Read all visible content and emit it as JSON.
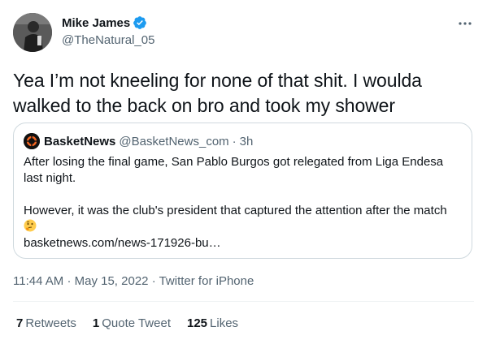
{
  "author": {
    "display_name": "Mike James",
    "handle": "@TheNatural_05"
  },
  "tweet": {
    "text": "Yea I’m not kneeling for none of that shit. I woulda walked to the back on bro and took my shower"
  },
  "quoted": {
    "display_name": "BasketNews",
    "handle": "@BasketNews_com",
    "separator": "·",
    "time": "3h",
    "paragraph_1": "After losing the final game, San Pablo Burgos got relegated from Liga Endesa last night.",
    "paragraph_2": "However, it was the club's president that captured the attention after the match",
    "link": "basketnews.com/news-171926-bu…"
  },
  "meta": {
    "time": "11:44 AM",
    "separator": "·",
    "date": "May 15, 2022",
    "source": "Twitter for iPhone"
  },
  "stats": {
    "retweets_count": "7",
    "retweets_label": "Retweets",
    "quotes_count": "1",
    "quotes_label": "Quote Tweet",
    "likes_count": "125",
    "likes_label": "Likes"
  },
  "icons": {
    "verified": "verified-badge-icon",
    "more": "more-options-icon",
    "quoted_avatar": "basketnews-logo",
    "emoji": "thinking-face-emoji"
  },
  "colors": {
    "text": "#0f1419",
    "secondary": "#536471",
    "verified": "#1d9bf0",
    "border": "#cfd9de",
    "divider": "#eff3f4"
  }
}
